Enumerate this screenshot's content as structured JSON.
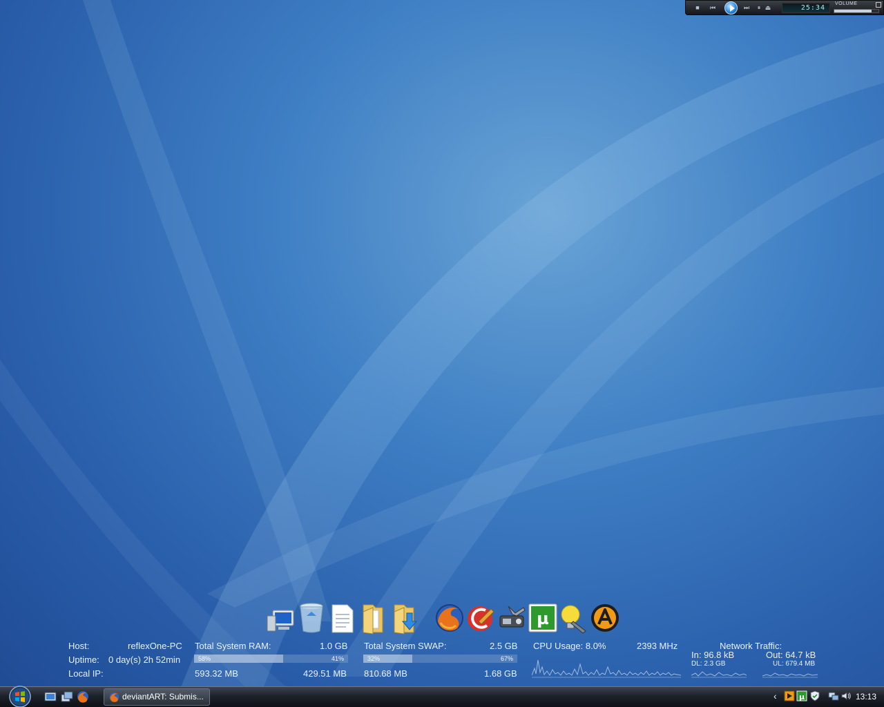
{
  "media_player": {
    "time": "25:34",
    "volume_label": "VOLUME",
    "volume_level": 0.85,
    "buttons": [
      "stop",
      "previous",
      "play",
      "next",
      "pause",
      "eject"
    ]
  },
  "dock": {
    "icons": [
      "computer-icon",
      "recycle-bin-icon",
      "document-icon",
      "documents-folder-icon",
      "downloads-folder-icon",
      "firefox-icon",
      "ccleaner-icon",
      "tools-icon",
      "utorrent-icon",
      "tweaks-bulb-icon",
      "aimp-icon"
    ]
  },
  "stats": {
    "host_label": "Host:",
    "host_value": "reflexOne-PC",
    "uptime_label": "Uptime:",
    "uptime_value": "0 day(s) 2h 52min",
    "ip_label": "Local IP:",
    "ram_label": "Total System RAM:",
    "ram_total": "1.0 GB",
    "ram_used_pct": "58%",
    "ram_free_pct": "41%",
    "ram_used": "593.32 MB",
    "ram_free": "429.51 MB",
    "ram_fill": 0.58,
    "swap_label": "Total System SWAP:",
    "swap_total": "2.5 GB",
    "swap_used_pct": "32%",
    "swap_free_pct": "67%",
    "swap_used": "810.68 MB",
    "swap_free": "1.68 GB",
    "swap_fill": 0.32,
    "cpu_label": "CPU Usage: 8.0%",
    "cpu_freq": "2393 MHz",
    "net_label": "Network Traffic:",
    "net_in": "In: 96.8 kB",
    "net_out": "Out: 64.7 kB",
    "net_dl": "DL: 2.3 GB",
    "net_ul": "UL: 679.4 MB"
  },
  "taskbar": {
    "quick_launch": [
      "show-desktop-icon",
      "switch-windows-icon",
      "firefox-icon"
    ],
    "task_firefox_label": "deviantART: Submis...",
    "tray_icons": [
      "aimp-tray-icon",
      "utorrent-tray-icon",
      "security-shield-icon",
      "network-icon",
      "volume-icon"
    ],
    "clock": "13:13"
  },
  "colors": {
    "wallpaper_base": "#2a5fab",
    "wallpaper_light": "#6aa4d6",
    "taskbar": "#1c2129"
  }
}
